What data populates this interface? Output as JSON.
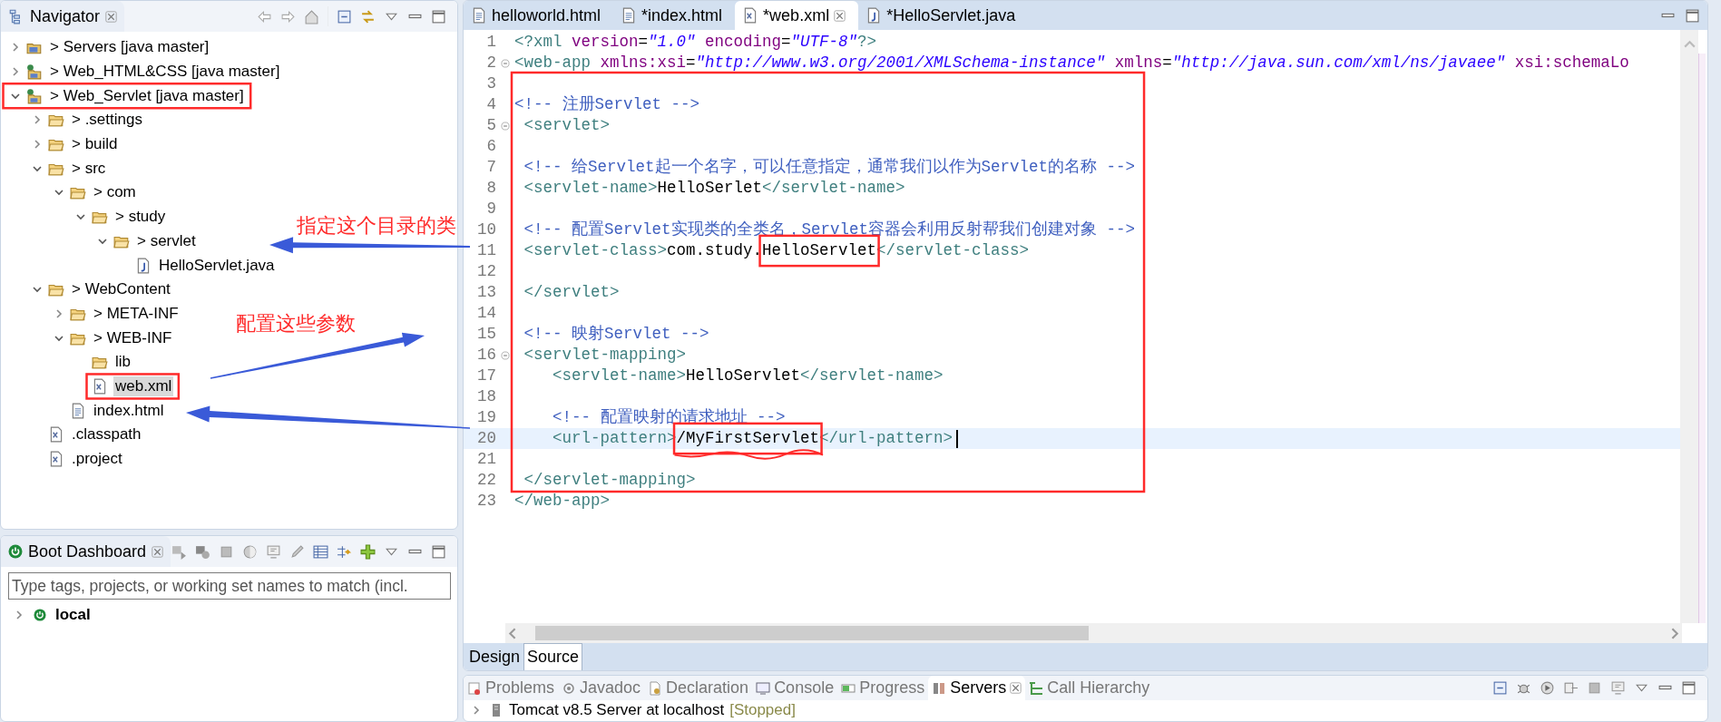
{
  "navigator": {
    "title": "Navigator",
    "tree": [
      {
        "label": "> Servers [java master]",
        "kind": "project",
        "expanded": false,
        "selected": false
      },
      {
        "label": "> Web_HTML&CSS [java master]",
        "kind": "web-project",
        "expanded": false,
        "selected": false
      },
      {
        "label": "> Web_Servlet [java master]",
        "kind": "web-project",
        "expanded": true,
        "selected": false,
        "highlight": true,
        "children": [
          {
            "label": "> .settings",
            "kind": "folder",
            "expanded": false,
            "selected": false
          },
          {
            "label": "> build",
            "kind": "folder",
            "expanded": false,
            "selected": false
          },
          {
            "label": "> src",
            "kind": "folder",
            "expanded": true,
            "selected": false,
            "children": [
              {
                "label": "> com",
                "kind": "folder",
                "expanded": true,
                "selected": false,
                "children": [
                  {
                    "label": "> study",
                    "kind": "folder",
                    "expanded": true,
                    "selected": false,
                    "children": [
                      {
                        "label": "> servlet",
                        "kind": "folder",
                        "expanded": true,
                        "selected": false,
                        "children": [
                          {
                            "label": "HelloServlet.java",
                            "kind": "java",
                            "selected": false
                          }
                        ]
                      }
                    ]
                  }
                ]
              }
            ]
          },
          {
            "label": "> WebContent",
            "kind": "folder",
            "expanded": true,
            "selected": false,
            "children": [
              {
                "label": "> META-INF",
                "kind": "folder",
                "expanded": false,
                "selected": false
              },
              {
                "label": "> WEB-INF",
                "kind": "folder",
                "expanded": true,
                "selected": false,
                "children": [
                  {
                    "label": "lib",
                    "kind": "folder",
                    "selected": false
                  },
                  {
                    "label": "web.xml",
                    "kind": "xml",
                    "selected": true,
                    "highlight": true
                  }
                ]
              },
              {
                "label": "index.html",
                "kind": "html",
                "selected": false
              }
            ]
          },
          {
            "label": ".classpath",
            "kind": "xml",
            "selected": false
          },
          {
            "label": ".project",
            "kind": "xml",
            "selected": false
          }
        ]
      }
    ]
  },
  "boot_dashboard": {
    "title": "Boot Dashboard",
    "search": {
      "placeholder": "Type tags, projects, or working set names to match (incl."
    },
    "tree": [
      {
        "label": "local",
        "expanded": false,
        "selected": false
      }
    ]
  },
  "editor": {
    "tabs": [
      {
        "label": "helloworld.html",
        "kind": "html",
        "selected": false
      },
      {
        "label": "*index.html",
        "kind": "html",
        "selected": false
      },
      {
        "label": "*web.xml",
        "kind": "xml",
        "selected": true
      },
      {
        "label": "*HelloServlet.java",
        "kind": "java",
        "selected": false
      }
    ],
    "lines": [
      {
        "number": "1",
        "fold": false,
        "current": false,
        "tokens": [
          {
            "kind": "tag",
            "text": "<?xml"
          },
          {
            "kind": "attr",
            "text": " version"
          },
          {
            "kind": "plain",
            "text": "="
          },
          {
            "kind": "value",
            "text": "\"1.0\""
          },
          {
            "kind": "attr",
            "text": " encoding"
          },
          {
            "kind": "plain",
            "text": "="
          },
          {
            "kind": "value",
            "text": "\"UTF-8\""
          },
          {
            "kind": "tag",
            "text": "?>"
          }
        ]
      },
      {
        "number": "2",
        "fold": true,
        "current": false,
        "tokens": [
          {
            "kind": "tag",
            "text": "<web-app"
          },
          {
            "kind": "attr",
            "text": " xmlns:xsi"
          },
          {
            "kind": "plain",
            "text": "="
          },
          {
            "kind": "value",
            "text": "\"http://www.w3.org/2001/XMLSchema-instance\""
          },
          {
            "kind": "attr",
            "text": " xmlns"
          },
          {
            "kind": "plain",
            "text": "="
          },
          {
            "kind": "value",
            "text": "\"http://java.sun.com/xml/ns/javaee\""
          },
          {
            "kind": "attr",
            "text": " xsi:schemaLo"
          }
        ]
      },
      {
        "number": "3",
        "fold": false,
        "current": false
      },
      {
        "number": "4",
        "fold": false,
        "current": false,
        "tokens": [
          {
            "kind": "comment",
            "text": "<!-- 注册Servlet -->"
          }
        ]
      },
      {
        "number": "5",
        "fold": true,
        "current": false,
        "tokens": [
          {
            "kind": "tag",
            "text": " <servlet>"
          }
        ]
      },
      {
        "number": "6",
        "fold": false,
        "current": false
      },
      {
        "number": "7",
        "fold": false,
        "current": false,
        "tokens": [
          {
            "kind": "comment",
            "text": " <!-- 给Servlet起一个名字，可以任意指定，通常我们以作为Servlet的名称 -->"
          }
        ]
      },
      {
        "number": "8",
        "fold": false,
        "current": false,
        "tokens": [
          {
            "kind": "tag",
            "text": " <servlet-name>"
          },
          {
            "kind": "plain",
            "text": "HelloSerlet"
          },
          {
            "kind": "tag",
            "text": "</servlet-name>"
          }
        ]
      },
      {
        "number": "9",
        "fold": false,
        "current": false
      },
      {
        "number": "10",
        "fold": false,
        "current": false,
        "tokens": [
          {
            "kind": "comment",
            "text": " <!-- 配置Servlet实现类的全类名，Servlet容器会利用反射帮我们创建对象 -->"
          }
        ]
      },
      {
        "number": "11",
        "fold": false,
        "current": false,
        "tokens": [
          {
            "kind": "tag",
            "text": " <servlet-class>"
          },
          {
            "kind": "plain",
            "text": "com.study."
          },
          {
            "kind": "plain",
            "text": "HelloServlet",
            "highlight": true
          },
          {
            "kind": "tag",
            "text": "</servlet-class>"
          }
        ]
      },
      {
        "number": "12",
        "fold": false,
        "current": false
      },
      {
        "number": "13",
        "fold": false,
        "current": false,
        "tokens": [
          {
            "kind": "tag",
            "text": " </servlet>"
          }
        ]
      },
      {
        "number": "14",
        "fold": false,
        "current": false
      },
      {
        "number": "15",
        "fold": false,
        "current": false,
        "tokens": [
          {
            "kind": "comment",
            "text": " <!-- 映射Servlet -->"
          }
        ]
      },
      {
        "number": "16",
        "fold": true,
        "current": false,
        "tokens": [
          {
            "kind": "tag",
            "text": " <servlet-mapping>"
          }
        ]
      },
      {
        "number": "17",
        "fold": false,
        "current": false,
        "tokens": [
          {
            "kind": "tag",
            "text": "    <servlet-name>"
          },
          {
            "kind": "plain",
            "text": "HelloServlet"
          },
          {
            "kind": "tag",
            "text": "</servlet-name>"
          }
        ]
      },
      {
        "number": "18",
        "fold": false,
        "current": false
      },
      {
        "number": "19",
        "fold": false,
        "current": false,
        "tokens": [
          {
            "kind": "comment",
            "text": "    <!-- 配置映射的请求地址 -->"
          }
        ]
      },
      {
        "number": "20",
        "fold": false,
        "current": true,
        "tokens": [
          {
            "kind": "tag",
            "text": "    <url-pattern>"
          },
          {
            "kind": "plain",
            "text": "/MyFirstServlet",
            "highlight": true
          },
          {
            "kind": "tag",
            "text": "</url-pattern>"
          }
        ]
      },
      {
        "number": "21",
        "fold": false,
        "current": false
      },
      {
        "number": "22",
        "fold": false,
        "current": false,
        "tokens": [
          {
            "kind": "tag",
            "text": " </servlet-mapping>"
          }
        ]
      },
      {
        "number": "23",
        "fold": false,
        "current": false,
        "tokens": [
          {
            "kind": "tag",
            "text": "</web-app>"
          }
        ]
      }
    ],
    "view_tabs": [
      {
        "label": "Design",
        "selected": false
      },
      {
        "label": "Source",
        "selected": true
      }
    ]
  },
  "bottom_panel": {
    "tabs": [
      {
        "label": "Problems",
        "kind": "problems",
        "selected": false
      },
      {
        "label": "Javadoc",
        "kind": "at",
        "selected": false
      },
      {
        "label": "Declaration",
        "kind": "declaration",
        "selected": false
      },
      {
        "label": "Console",
        "kind": "console",
        "selected": false
      },
      {
        "label": "Progress",
        "kind": "progress",
        "selected": false
      },
      {
        "label": "Servers",
        "kind": "servers",
        "selected": true
      },
      {
        "label": "Call Hierarchy",
        "kind": "hierarchy",
        "selected": false
      }
    ],
    "rows": [
      {
        "label": "Tomcat v8.5 Server at localhost",
        "status": "[Stopped]",
        "expanded": false
      }
    ]
  },
  "annotations": [
    {
      "text": "指定这个目录的类"
    },
    {
      "text": "配置这些参数"
    }
  ]
}
